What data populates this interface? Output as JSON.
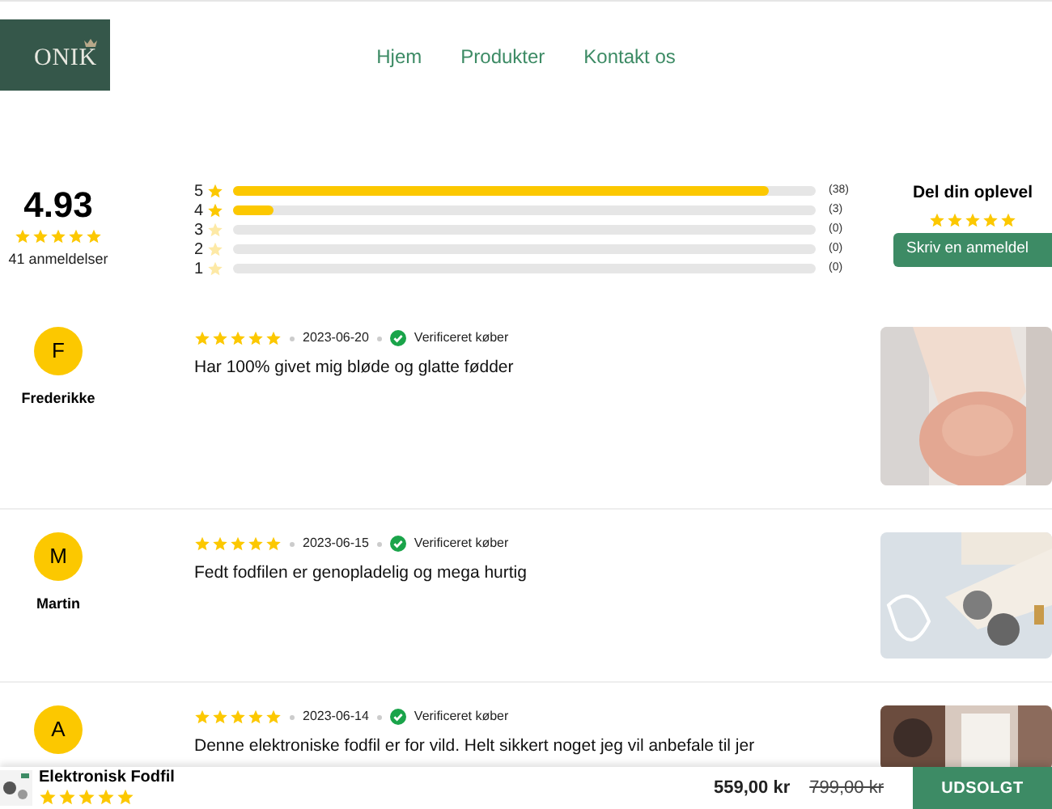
{
  "header": {
    "logo_text": "ONIK",
    "nav": [
      {
        "label": "Hjem"
      },
      {
        "label": "Produkter"
      },
      {
        "label": "Kontakt os"
      }
    ]
  },
  "summary": {
    "average": "4.93",
    "stars": 5,
    "count": "41 anmeldelser",
    "distribution": [
      {
        "label": "5",
        "level": 0.92,
        "count": "(38)"
      },
      {
        "label": "4",
        "level": 0.07,
        "count": "(3)"
      },
      {
        "label": "3",
        "level": 0,
        "count": "(0)"
      },
      {
        "label": "2",
        "level": 0,
        "count": "(0)"
      },
      {
        "label": "1",
        "level": 0,
        "count": "(0)"
      }
    ]
  },
  "share": {
    "title": "Del din oplevel",
    "stars": 5,
    "button": "Skriv en anmeldel"
  },
  "reviews": [
    {
      "initial": "F",
      "name": "Frederikke",
      "stars": 5,
      "date": "2023-06-20",
      "badge": "Verificeret køber",
      "text": "Har 100% givet mig bløde og glatte fødder"
    },
    {
      "initial": "M",
      "name": "Martin",
      "stars": 5,
      "date": "2023-06-15",
      "badge": "Verificeret køber",
      "text": "Fedt fodfilen er genopladelig og mega hurtig"
    },
    {
      "initial": "A",
      "stars": 5,
      "date": "2023-06-14",
      "badge": "Verificeret køber",
      "text": "Denne elektroniske fodfil er for vild. Helt sikkert noget jeg vil anbefale til jer"
    }
  ],
  "sticky_bar": {
    "title": "Elektronisk Fodfil",
    "stars": 5,
    "price": "559,00 kr",
    "old_price": "799,00 kr",
    "button": "UDSOLGT"
  }
}
